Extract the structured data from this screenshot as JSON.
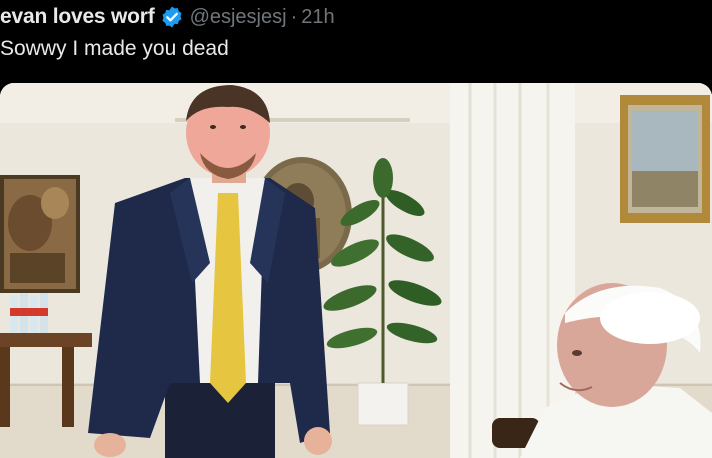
{
  "tweet": {
    "display_name": "evan loves worf",
    "handle": "@esjesjesj",
    "separator": "·",
    "timestamp": "21h",
    "verified_icon": "verified-badge-icon",
    "text": "Sowwy I made you dead"
  },
  "media": {
    "type": "photo"
  },
  "colors": {
    "background": "#000000",
    "primary_text": "#e7e9ea",
    "secondary_text": "#71767b",
    "verified_blue": "#1d9bf0"
  }
}
